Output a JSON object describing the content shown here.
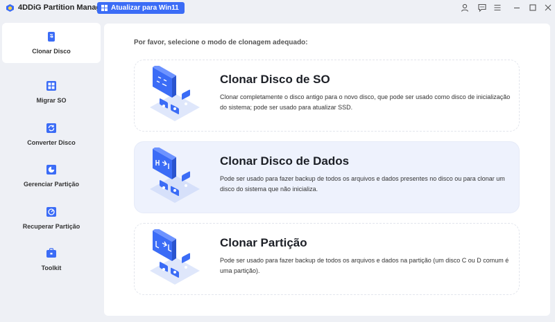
{
  "app": {
    "title": "4DDiG Partition Manager",
    "upgrade_label": "Atualizar para Win11",
    "accent_color": "#3b6cf6"
  },
  "titlebar_icons": [
    "user-icon",
    "feedback-icon",
    "menu-icon",
    "minimize-icon",
    "maximize-icon",
    "close-icon"
  ],
  "sidebar": {
    "items": [
      {
        "label": "Clonar Disco",
        "icon": "clone-disk-icon",
        "active": true
      },
      {
        "label": "Migrar SO",
        "icon": "migrate-os-icon",
        "active": false
      },
      {
        "label": "Converter Disco",
        "icon": "convert-disk-icon",
        "active": false
      },
      {
        "label": "Gerenciar Partição",
        "icon": "manage-partition-icon",
        "active": false
      },
      {
        "label": "Recuperar Partição",
        "icon": "recover-partition-icon",
        "active": false
      },
      {
        "label": "Toolkit",
        "icon": "toolkit-icon",
        "active": false
      }
    ]
  },
  "main": {
    "prompt": "Por favor, selecione o modo de clonagem adequado:",
    "options": [
      {
        "title": "Clonar Disco de SO",
        "description": "Clonar completamente o disco antigo para o novo disco, que pode ser usado como disco de inicialização do sistema; pode ser usado para atualizar SSD.",
        "icon": "os-disk-clone-illustration",
        "selected": false
      },
      {
        "title": "Clonar Disco de Dados",
        "description": "Pode ser usado para fazer backup de todos os arquivos e dados presentes no disco ou para clonar um disco do sistema que não inicializa.",
        "icon": "data-disk-clone-illustration",
        "selected": true
      },
      {
        "title": "Clonar Partição",
        "description": "Pode ser usado para fazer backup de todos os arquivos e dados na partição (um disco C ou D comum é uma partição).",
        "icon": "partition-clone-illustration",
        "selected": false
      }
    ]
  }
}
